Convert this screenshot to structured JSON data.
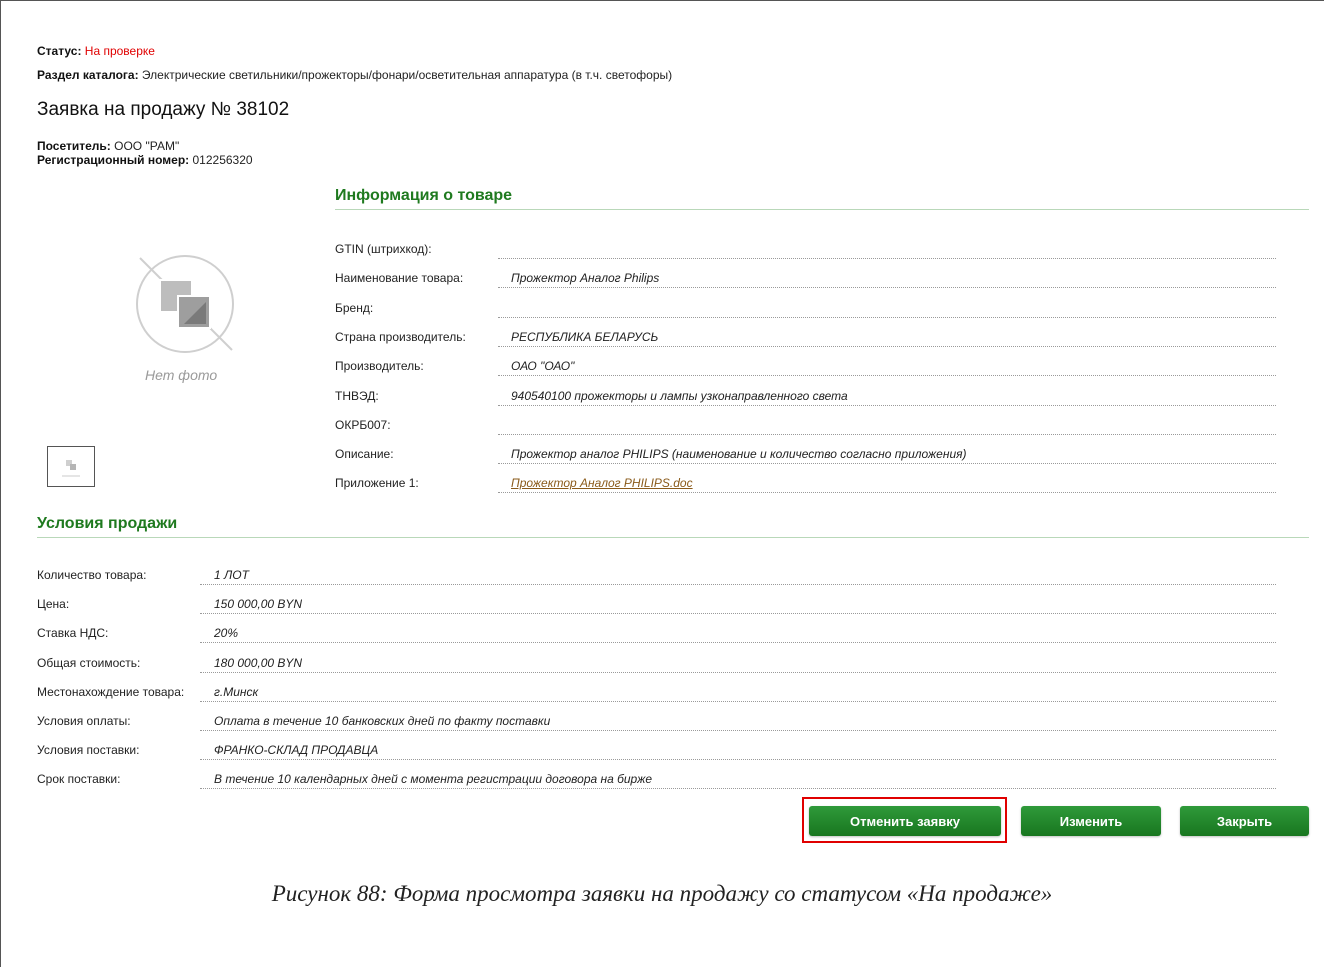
{
  "header": {
    "status_label": "Статус:",
    "status_value": "На проверке",
    "catalog_label": "Раздел каталога:",
    "catalog_value": "Электрические светильники/прожекторы/фонари/осветительная аппаратура (в т.ч. светофоры)",
    "title": "Заявка на продажу № 38102",
    "visitor_label": "Посетитель:",
    "visitor_value": "ООО \"РАМ\"",
    "regnum_label": "Регистрационный номер:",
    "regnum_value": "012256320"
  },
  "photo": {
    "no_photo_text": "Нет фото",
    "icon": "no-image-icon"
  },
  "product_info": {
    "heading": "Информация о товаре",
    "rows": [
      {
        "label": "GTIN (штрихкод):",
        "value": ""
      },
      {
        "label": "Наименование товара:",
        "value": "Прожектор Аналог Philips"
      },
      {
        "label": "Бренд:",
        "value": ""
      },
      {
        "label": "Страна производитель:",
        "value": "РЕСПУБЛИКА БЕЛАРУСЬ"
      },
      {
        "label": "Производитель:",
        "value": "ОАО \"ОАО\""
      },
      {
        "label": "ТНВЭД:",
        "value": "940540100 прожекторы и лампы узконаправленного света"
      },
      {
        "label": "ОКРБ007:",
        "value": ""
      },
      {
        "label": "Описание:",
        "value": "Прожектор аналог PHILIPS (наименование и количество согласно приложения)"
      },
      {
        "label": "Приложение 1:",
        "value": "Прожектор Аналог PHILIPS.doc"
      }
    ]
  },
  "sale_terms": {
    "heading": "Условия продажи",
    "rows": [
      {
        "label": "Количество товара:",
        "value": "1 ЛОТ"
      },
      {
        "label": "Цена:",
        "value": "150 000,00 BYN"
      },
      {
        "label": "Ставка НДС:",
        "value": "20%"
      },
      {
        "label": "Общая стоимость:",
        "value": "180 000,00 BYN"
      },
      {
        "label": "Местонахождение товара:",
        "value": "г.Минск"
      },
      {
        "label": "Условия оплаты:",
        "value": "Оплата в течение 10 банковских дней по факту поставки"
      },
      {
        "label": "Условия поставки:",
        "value": "ФРАНКО-СКЛАД ПРОДАВЦА"
      },
      {
        "label": "Срок поставки:",
        "value": "В течение 10 календарных дней с момента регистрации договора на бирже"
      }
    ]
  },
  "buttons": {
    "cancel": "Отменить заявку",
    "edit": "Изменить",
    "close": "Закрыть"
  },
  "caption": "Рисунок 88: Форма просмотра заявки на продажу со статусом «На продаже»",
  "colors": {
    "status": "#e00000",
    "section_heading": "#1f7a1f",
    "button": "#18761f",
    "highlight": "#e00000"
  }
}
